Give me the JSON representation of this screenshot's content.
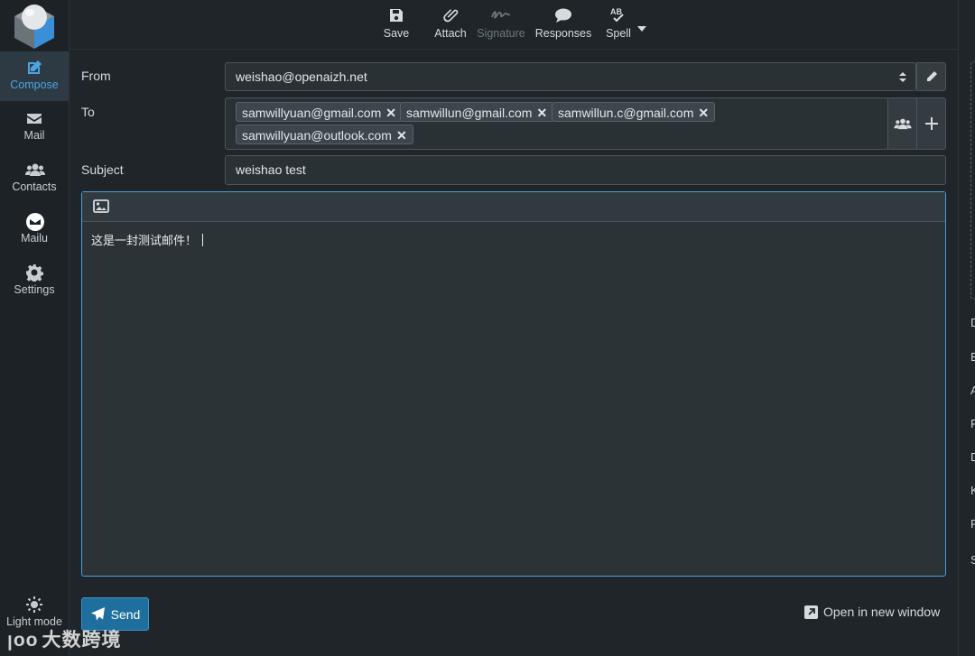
{
  "nav": {
    "compose": "Compose",
    "mail": "Mail",
    "contacts": "Contacts",
    "mailu": "Mailu",
    "settings": "Settings",
    "light_mode": "Light mode"
  },
  "toolbar": {
    "save": "Save",
    "attach": "Attach",
    "signature": "Signature",
    "responses": "Responses",
    "spell": "Spell",
    "spell_badge": "AB"
  },
  "form": {
    "from_label": "From",
    "from_value": "weishao@openaizh.net",
    "to_label": "To",
    "recipients": [
      "samwillyuan@gmail.com",
      "samwillun@gmail.com",
      "samwillun.c@gmail.com",
      "samwillyuan@outlook.com"
    ],
    "subject_label": "Subject",
    "subject_value": "weishao test"
  },
  "editor": {
    "body": "这是一封测试邮件！"
  },
  "actions": {
    "send": "Send",
    "open_new_window": "Open in new window"
  },
  "right_letters": [
    "D",
    "E",
    "A",
    "F",
    "D",
    "K",
    "F",
    "S"
  ],
  "watermark": "大数跨境",
  "colors": {
    "accent": "#4ca6e4",
    "send_button": "#1f6f9e",
    "background": "#1f2529"
  }
}
